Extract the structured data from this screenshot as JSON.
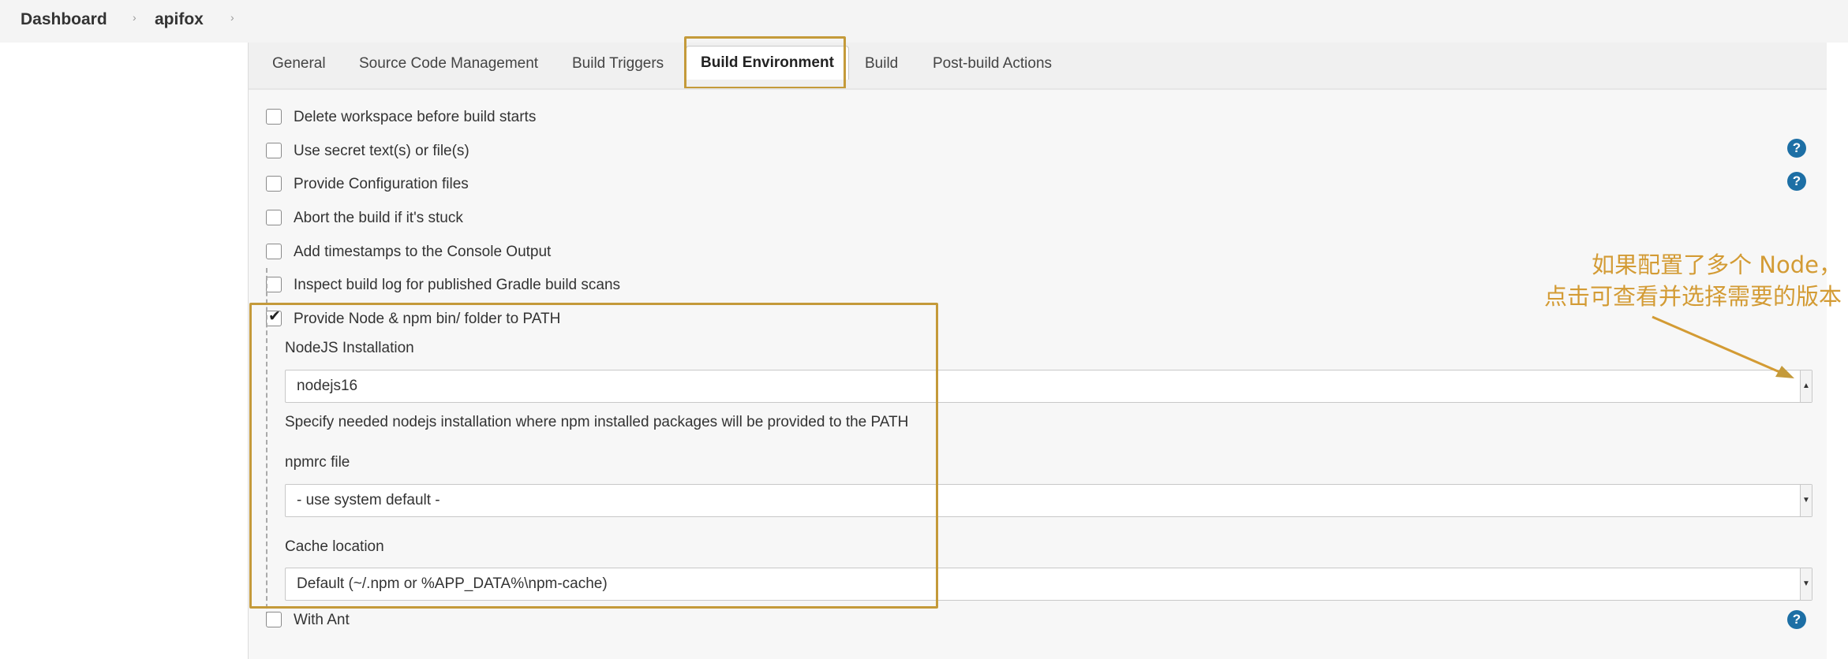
{
  "breadcrumb": {
    "items": [
      "Dashboard",
      "apifox"
    ],
    "separator": "›"
  },
  "tabs": [
    {
      "label": "General"
    },
    {
      "label": "Source Code Management"
    },
    {
      "label": "Build Triggers"
    },
    {
      "label": "Build Environment",
      "active": true
    },
    {
      "label": "Build"
    },
    {
      "label": "Post-build Actions"
    }
  ],
  "options": [
    {
      "label": "Delete workspace before build starts",
      "checked": false,
      "help": false
    },
    {
      "label": "Use secret text(s) or file(s)",
      "checked": false,
      "help": true
    },
    {
      "label": "Provide Configuration files",
      "checked": false,
      "help": true
    },
    {
      "label": "Abort the build if it's stuck",
      "checked": false,
      "help": false
    },
    {
      "label": "Add timestamps to the Console Output",
      "checked": false,
      "help": false
    },
    {
      "label": "Inspect build log for published Gradle build scans",
      "checked": false,
      "help": false
    },
    {
      "label": "Provide Node & npm bin/ folder to PATH",
      "checked": true,
      "help": false
    }
  ],
  "node": {
    "installation_label": "NodeJS Installation",
    "installation_value": "nodejs16",
    "installation_help": "Specify needed nodejs installation where npm installed packages will be provided to the PATH",
    "npmrc_label": "npmrc file",
    "npmrc_value": "- use system default -",
    "cache_label": "Cache location",
    "cache_value": "Default (~/.npm or %APP_DATA%\\npm-cache)"
  },
  "with_ant": {
    "label": "With Ant",
    "checked": false,
    "help": true
  },
  "help_icon_glyph": "?",
  "annotation": {
    "line1": "如果配置了多个 Node，",
    "line2": "点击可查看并选择需要的版本"
  },
  "colors": {
    "highlight": "#c49a3a",
    "annotation": "#d39b34",
    "help_icon": "#1d6fa5"
  }
}
